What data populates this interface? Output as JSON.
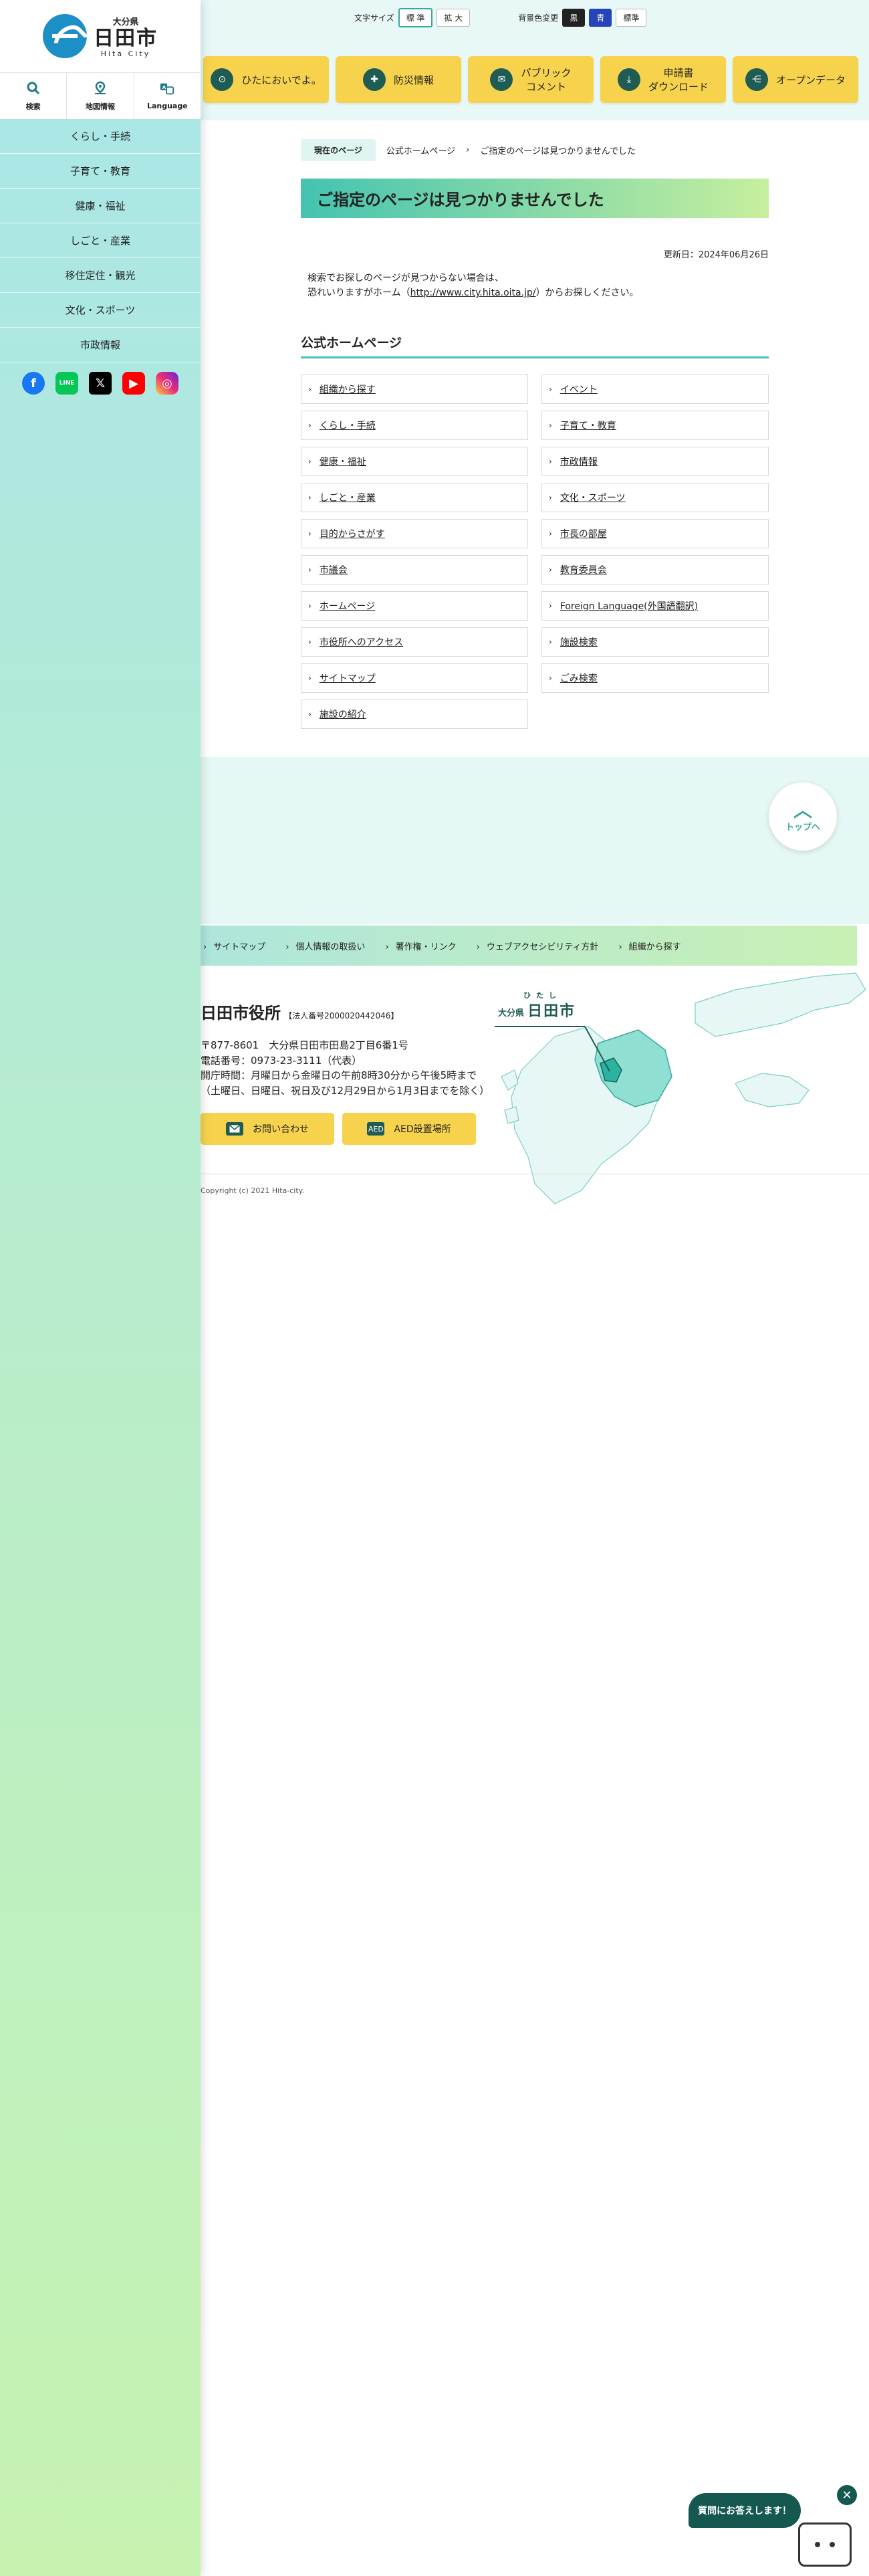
{
  "logo": {
    "prefecture": "大分県",
    "city": "日田市",
    "romaji": "Hita City"
  },
  "quick_nav": [
    {
      "label": "検索",
      "icon": "search-icon"
    },
    {
      "label": "地図情報",
      "icon": "map-pin-icon"
    },
    {
      "label": "Language",
      "icon": "language-icon"
    }
  ],
  "sidebar_nav": [
    "くらし・手続",
    "子育て・教育",
    "健康・福祉",
    "しごと・産業",
    "移住定住・観光",
    "文化・スポーツ",
    "市政情報"
  ],
  "sns": [
    "facebook-icon",
    "line-icon",
    "x-icon",
    "youtube-icon",
    "instagram-icon"
  ],
  "sns_text": {
    "line": "LINE",
    "x": "𝕏",
    "fb": "f",
    "yt": "▶",
    "ig": "◎"
  },
  "util": {
    "font_size_label": "文字サイズ",
    "font_standard": "標 準",
    "font_large": "拡 大",
    "bg_label": "背景色変更",
    "bg_black": "黒",
    "bg_blue": "青",
    "bg_standard": "標準"
  },
  "features": [
    {
      "label": "ひたにおいでよ。",
      "icon": "hita-logo-icon",
      "glyph": "⊙"
    },
    {
      "label": "防災情報",
      "icon": "first-aid-icon",
      "glyph": "✚"
    },
    {
      "label": "パブリック\nコメント",
      "icon": "chat-icon",
      "glyph": "✉"
    },
    {
      "label": "申請書\nダウンロード",
      "icon": "download-icon",
      "glyph": "⤓"
    },
    {
      "label": "オープンデータ",
      "icon": "share-icon",
      "glyph": "⋲"
    }
  ],
  "breadcrumb": {
    "label": "現在のページ",
    "home": "公式ホームページ",
    "sep": "›",
    "current": "ご指定のページは見つかりませんでした"
  },
  "page_title": "ご指定のページは見つかりませんでした",
  "updated": "更新日：2024年06月26日",
  "notice": {
    "line1": "検索でお探しのページが見つからない場合は、",
    "line2_pre": "恐れいりますがホーム（",
    "line2_link": "http://www.city.hita.oita.jp/",
    "line2_post": "）からお探しください。"
  },
  "section_title": "公式ホームページ",
  "links": [
    "組織から探す",
    "イベント",
    "くらし・手続",
    "子育て・教育",
    "健康・福祉",
    "市政情報",
    "しごと・産業",
    "文化・スポーツ",
    "目的からさがす",
    "市長の部屋",
    "市議会",
    "教育委員会",
    "ホームページ",
    "Foreign Language(外国語翻訳)",
    "市役所へのアクセス",
    "施設検索",
    "サイトマップ",
    "ごみ検索",
    "施設の紹介"
  ],
  "chev": "›",
  "to_top": {
    "arrow": "︿",
    "label": "トップへ"
  },
  "footer_links": [
    "サイトマップ",
    "個人情報の取扱い",
    "著作権・リンク",
    "ウェブアクセシビリティ方針",
    "組織から探す"
  ],
  "footer": {
    "office_name": "日田市役所",
    "corp_no": "【法人番号2000020442046】",
    "address": "〒877-8601　大分県日田市田島2丁目6番1号",
    "phone": "電話番号：0973-23-3111（代表）",
    "hours": "開庁時間：月曜日から金曜日の午前8時30分から午後5時まで",
    "hours2": "（土曜日、日曜日、祝日及び12月29日から1月3日までを除く）",
    "contact_btn": "お問い合わせ",
    "aed_btn": "AED設置場所",
    "aed_icon_text": "AED"
  },
  "map_label": {
    "prefecture": "大分県",
    "ruby": "ひたし",
    "city": "日田市"
  },
  "copyright": "Copyright (c) 2021 Hita-city.",
  "chat": {
    "bubble": "質問にお答えします！",
    "close": "✕"
  },
  "colors": {
    "accent": "#44c3b1",
    "yellow": "#f7d34d",
    "dark_green": "#1f5c54"
  }
}
